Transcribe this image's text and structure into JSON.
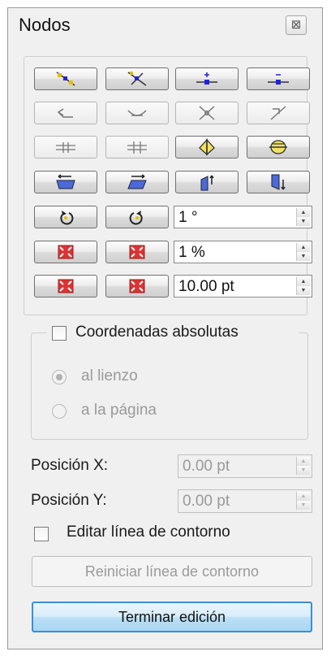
{
  "panel": {
    "title": "Nodos",
    "close_glyph": "⊠"
  },
  "toolbar": {
    "icons": [
      "add-node-icon",
      "delete-node-icon",
      "join-nodes-icon",
      "break-node-icon",
      "make-corner-icon",
      "make-smooth-icon",
      "line-to-curve-icon",
      "curve-to-line-icon",
      "align-horizontal-icon",
      "align-vertical-icon",
      "flip-horizontal-icon",
      "flip-vertical-icon",
      "skew-left-icon",
      "skew-right-icon",
      "stretch-up-icon",
      "stretch-down-icon",
      "rotate-ccw-icon",
      "rotate-cw-icon",
      "scale-down-icon",
      "scale-up-icon",
      "move-in-icon",
      "move-out-icon"
    ],
    "rotate_value": "1 °",
    "scale_value": "1 %",
    "offset_value": "10.00 pt"
  },
  "coords": {
    "absolute_label": "Coordenadas absolutas",
    "option_canvas": "al lienzo",
    "option_page": "a la página",
    "selected": "al lienzo"
  },
  "position": {
    "x_label": "Posición X:",
    "x_value": "0.00 pt",
    "y_label": "Posición Y:",
    "y_value": "0.00 pt"
  },
  "outline": {
    "edit_label": "Editar línea de contorno",
    "reset_label": "Reiniciar línea de contorno"
  },
  "actions": {
    "finish_label": "Terminar edición"
  },
  "colors": {
    "node_blue": "#2222dd",
    "node_yellow": "#e0c000",
    "accent": "#3b8fd6"
  }
}
